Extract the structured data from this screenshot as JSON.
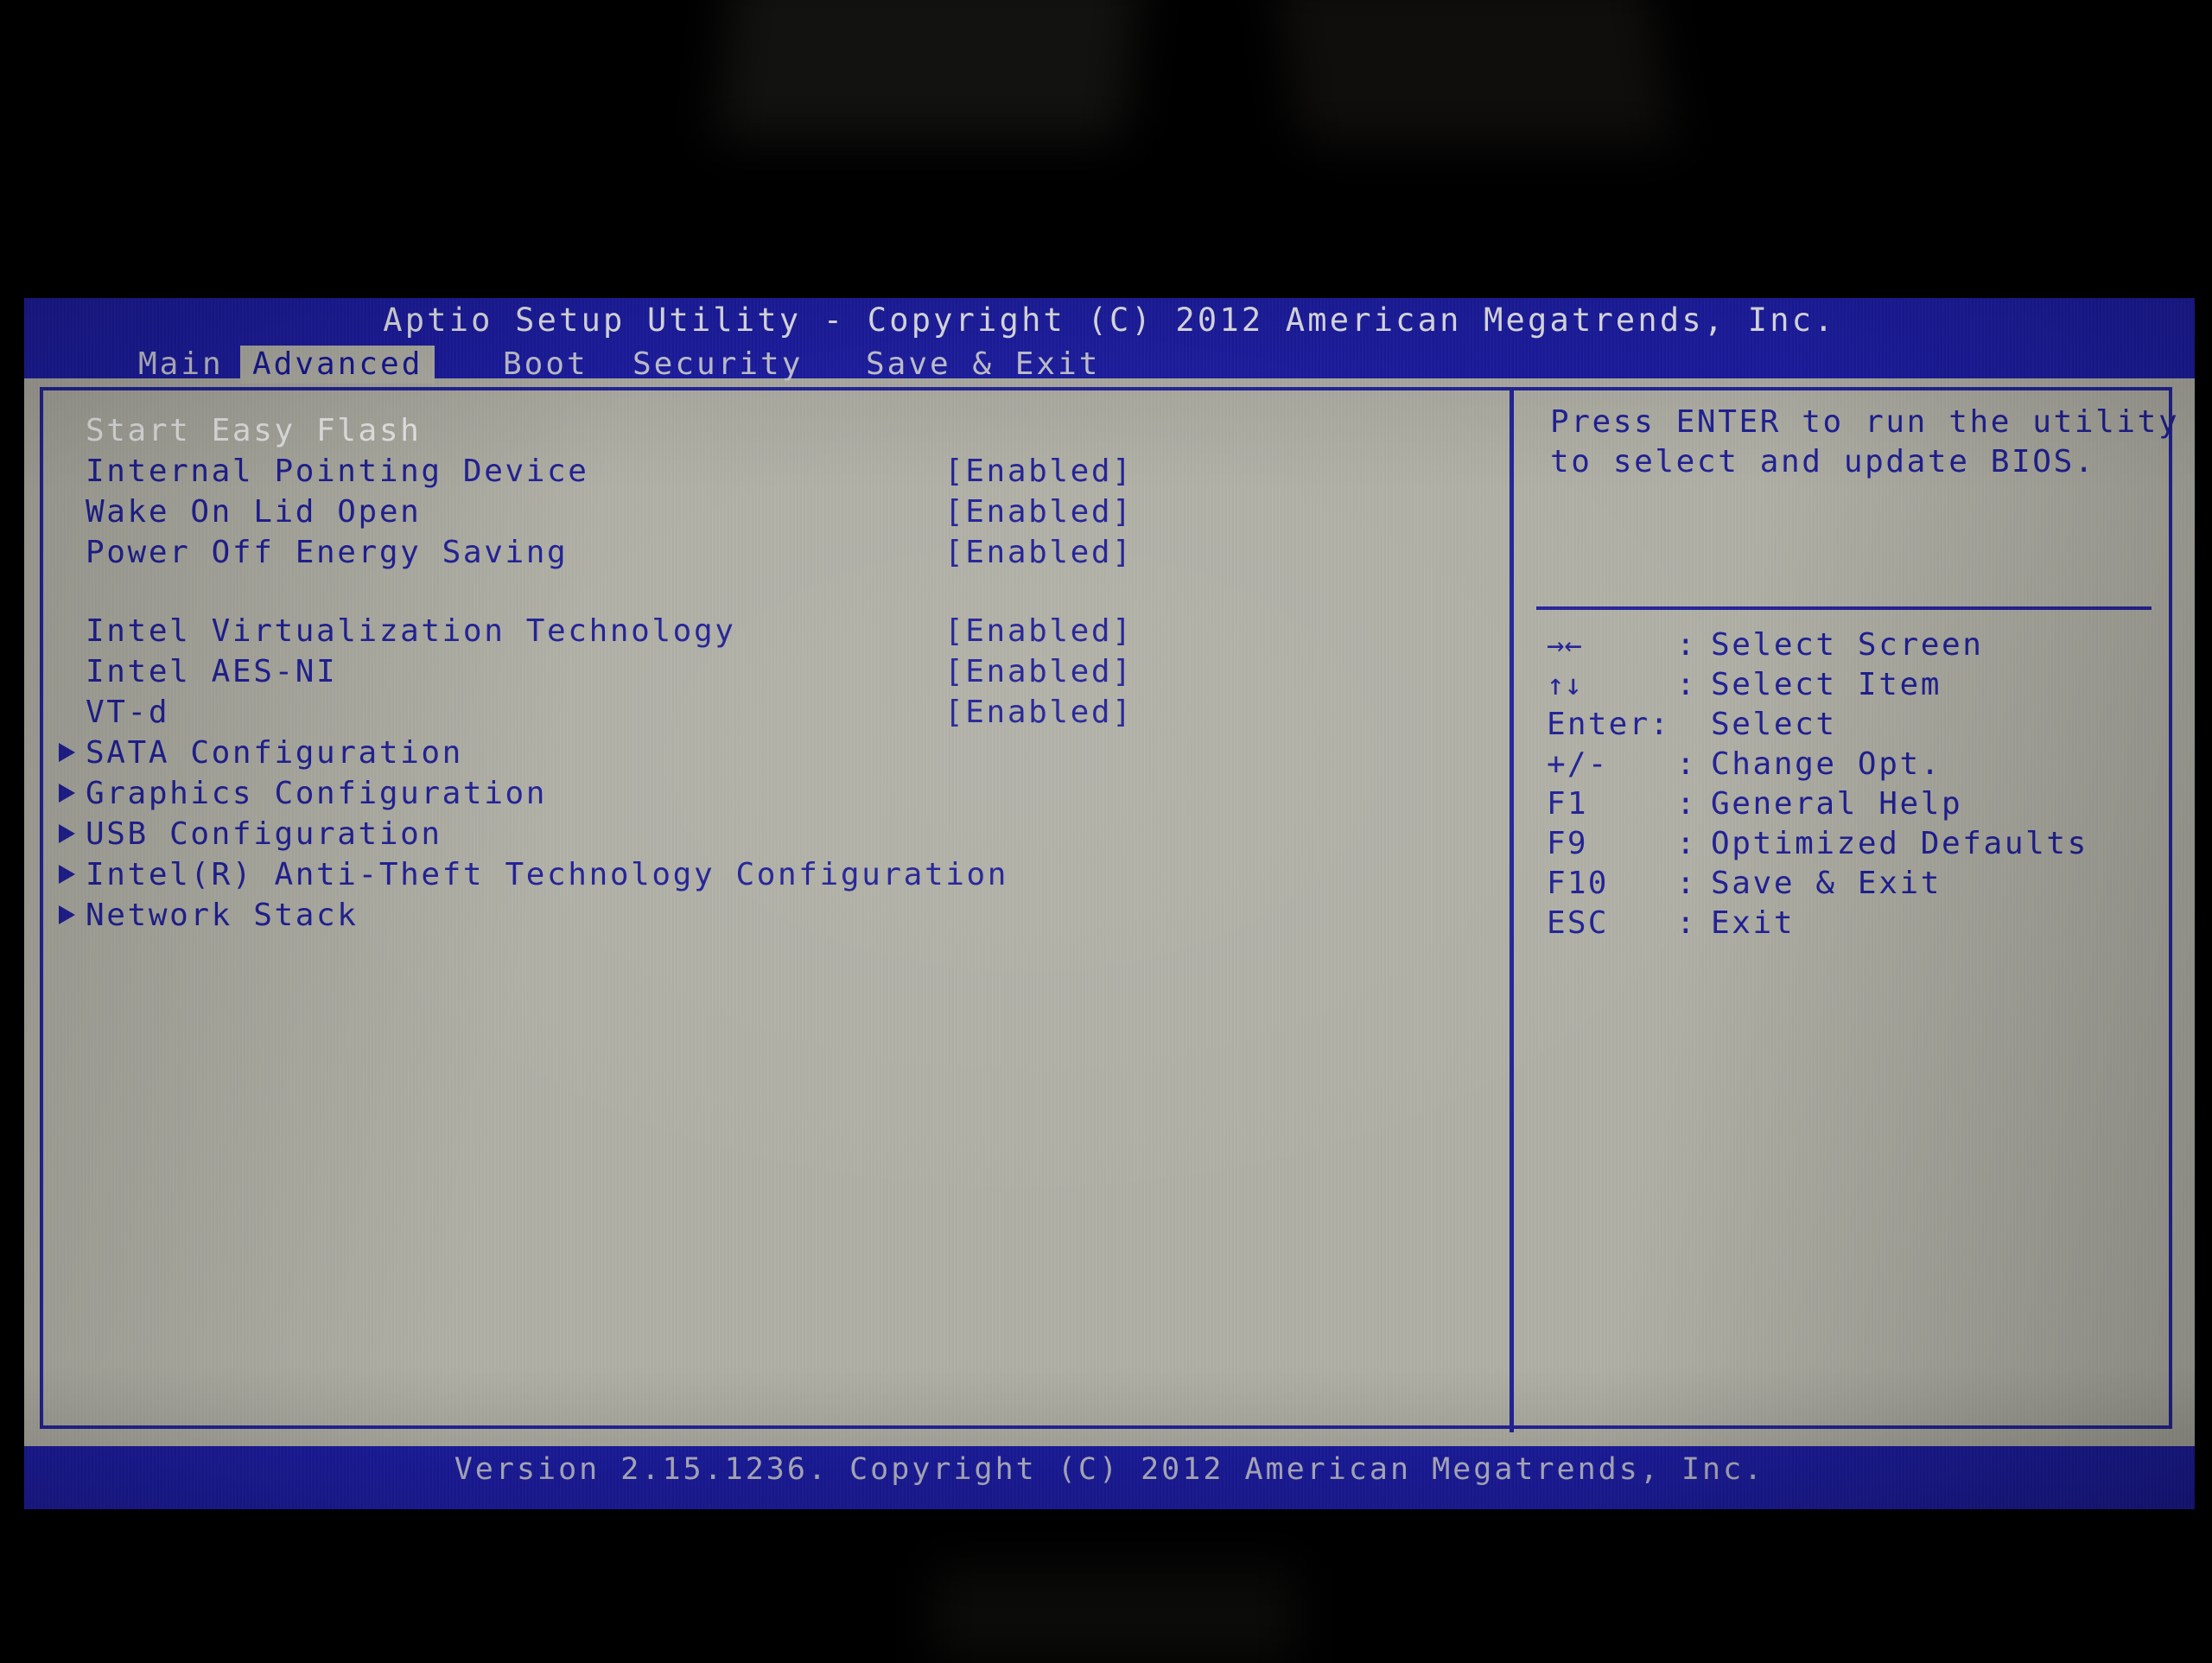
{
  "titlebar": {
    "title": "Aptio Setup Utility - Copyright (C) 2012 American Megatrends, Inc."
  },
  "tabs": [
    {
      "label": "Main",
      "active": false
    },
    {
      "label": "Advanced",
      "active": true
    },
    {
      "label": "Boot",
      "active": false
    },
    {
      "label": "Security",
      "active": false
    },
    {
      "label": "Save & Exit",
      "active": false
    }
  ],
  "options": [
    {
      "label": "Start Easy Flash",
      "value": "",
      "submenu": false,
      "selected": true
    },
    {
      "label": "Internal Pointing Device",
      "value": "[Enabled]",
      "submenu": false,
      "selected": false
    },
    {
      "label": "Wake On Lid Open",
      "value": "[Enabled]",
      "submenu": false,
      "selected": false
    },
    {
      "label": "Power Off Energy Saving",
      "value": "[Enabled]",
      "submenu": false,
      "selected": false
    },
    {
      "label": "Intel Virtualization Technology",
      "value": "[Enabled]",
      "submenu": false,
      "selected": false
    },
    {
      "label": "Intel AES-NI",
      "value": "[Enabled]",
      "submenu": false,
      "selected": false
    },
    {
      "label": "VT-d",
      "value": "[Enabled]",
      "submenu": false,
      "selected": false
    },
    {
      "label": "SATA Configuration",
      "value": "",
      "submenu": true,
      "selected": false
    },
    {
      "label": "Graphics Configuration",
      "value": "",
      "submenu": true,
      "selected": false
    },
    {
      "label": "USB Configuration",
      "value": "",
      "submenu": true,
      "selected": false
    },
    {
      "label": "Intel(R) Anti-Theft Technology Configuration",
      "value": "",
      "submenu": true,
      "selected": false
    },
    {
      "label": "Network Stack",
      "value": "",
      "submenu": true,
      "selected": false
    }
  ],
  "help": {
    "line1": "Press ENTER to run the utility",
    "line2": "to select and update BIOS."
  },
  "legend": [
    {
      "key": "→←",
      "glyph": true,
      "colon": ":",
      "desc": "Select Screen"
    },
    {
      "key": "↑↓",
      "glyph": true,
      "colon": ":",
      "desc": "Select Item"
    },
    {
      "key": "Enter:",
      "glyph": false,
      "colon": "",
      "desc": "Select"
    },
    {
      "key": "+/-",
      "glyph": false,
      "colon": ":",
      "desc": "Change Opt."
    },
    {
      "key": "F1",
      "glyph": false,
      "colon": ":",
      "desc": "General Help"
    },
    {
      "key": "F9",
      "glyph": false,
      "colon": ":",
      "desc": "Optimized Defaults"
    },
    {
      "key": "F10",
      "glyph": false,
      "colon": ":",
      "desc": "Save & Exit"
    },
    {
      "key": "ESC",
      "glyph": false,
      "colon": ":",
      "desc": "Exit"
    }
  ],
  "footer": {
    "version": "Version 2.15.1236. Copyright (C) 2012 American Megatrends, Inc."
  },
  "colors": {
    "bios_blue": "#1c1ca4",
    "panel_gray": "#b0b0a6",
    "text_blue": "#1f1f96",
    "text_white": "#f2f2f2",
    "tab_active": "#b6b5ab",
    "border_blue": "#232399"
  }
}
